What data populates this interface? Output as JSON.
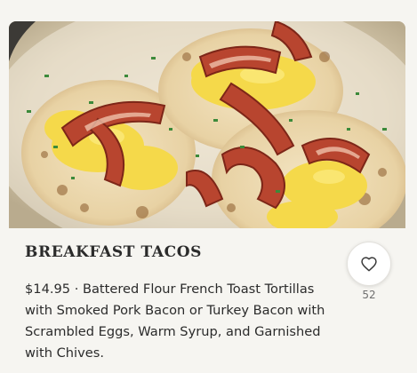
{
  "item": {
    "image_alt": "Breakfast tacos with bacon and scrambled eggs",
    "title": "BREAKFAST TACOS",
    "description": "$14.95 · Battered Flour French Toast Tortillas with Smoked Pork Bacon or Turkey Bacon with Scrambled Eggs, Warm Syrup, and Garnished with Chives.",
    "favorite_icon": "heart-outline-icon",
    "favorite_count": "52"
  }
}
